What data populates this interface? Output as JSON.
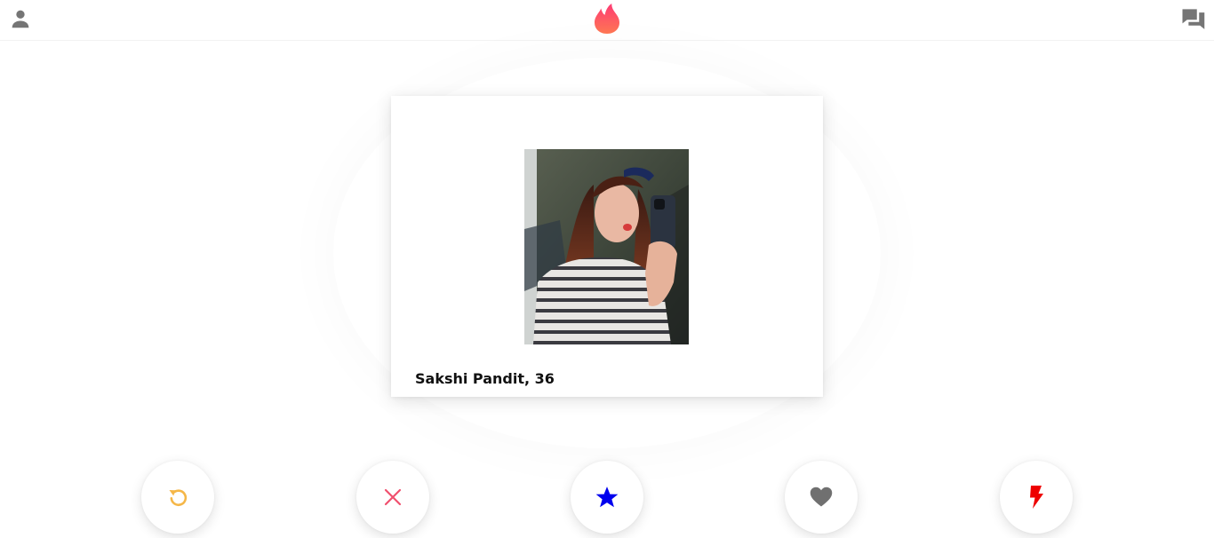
{
  "header": {
    "profile_icon": "person-icon",
    "logo_icon": "flame-icon",
    "messages_icon": "chat-bubbles-icon",
    "logo_color": "#fd5068"
  },
  "card": {
    "name": "Sakshi Pandit, 36",
    "photo": "profile-photo"
  },
  "actions": [
    {
      "name": "rewind",
      "icon": "rewind-icon",
      "color": "#f5b748"
    },
    {
      "name": "nope",
      "icon": "close-icon",
      "color": "#f0506e"
    },
    {
      "name": "super-like",
      "icon": "star-icon",
      "color": "#0000ee"
    },
    {
      "name": "like",
      "icon": "heart-icon",
      "color": "#707070"
    },
    {
      "name": "boost",
      "icon": "lightning-icon",
      "color": "#ee0000"
    }
  ],
  "colors": {
    "icon_gray": "#757575",
    "background": "#ffffff"
  }
}
